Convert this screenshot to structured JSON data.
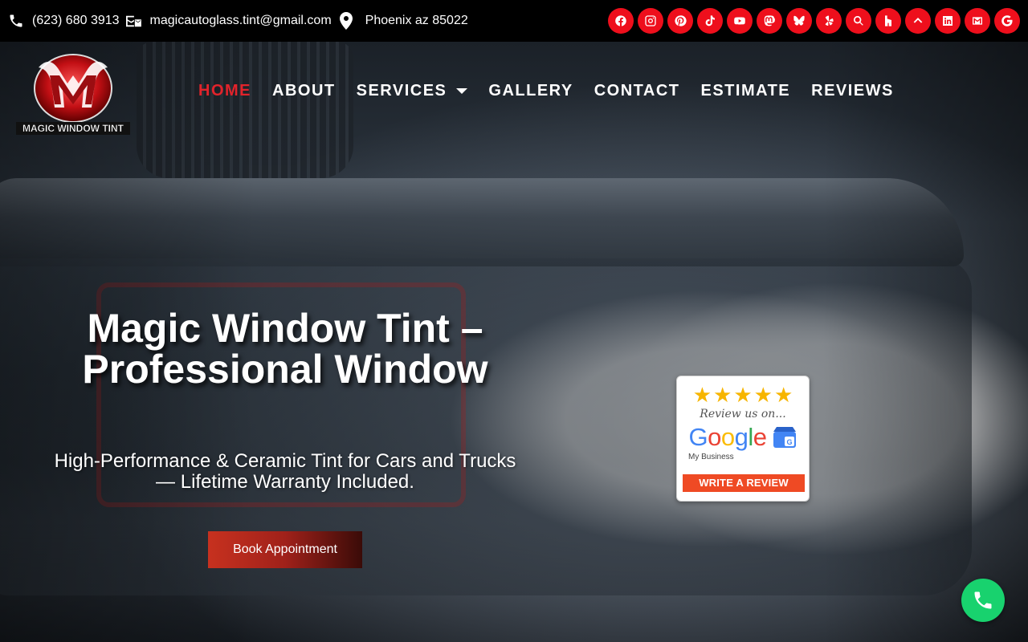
{
  "topbar": {
    "phone": "(623) 680 3913",
    "email": "magicautoglass.tint@gmail.com",
    "location": "Phoenix az 85022",
    "socials": [
      "facebook-icon",
      "instagram-icon",
      "pinterest-icon",
      "tiktok-icon",
      "youtube-icon",
      "mastodon-icon",
      "bluesky-icon",
      "yelp-icon",
      "search-icon",
      "houzz-icon",
      "upward-icon",
      "linkedin-icon",
      "gmail-icon",
      "google-icon"
    ]
  },
  "logo": {
    "text": "MAGIC WINDOW TINT"
  },
  "nav": {
    "items": [
      "HOME",
      "ABOUT",
      "SERVICES",
      "GALLERY",
      "CONTACT",
      "ESTIMATE",
      "REVIEWS"
    ],
    "active": "HOME"
  },
  "hero": {
    "title": "Magic Window Tint – Professional Window",
    "subtitle": "High-Performance & Ceramic Tint for Cars and Trucks — Lifetime Warranty Included.",
    "cta": "Book Appointment"
  },
  "review_badge": {
    "review_on": "Review us on...",
    "google_sub": "My Business",
    "button": "WRITE A REVIEW"
  },
  "colors": {
    "accent_red": "#ee0f1c",
    "nav_active": "#e2232b",
    "call_green": "#18d26e"
  }
}
